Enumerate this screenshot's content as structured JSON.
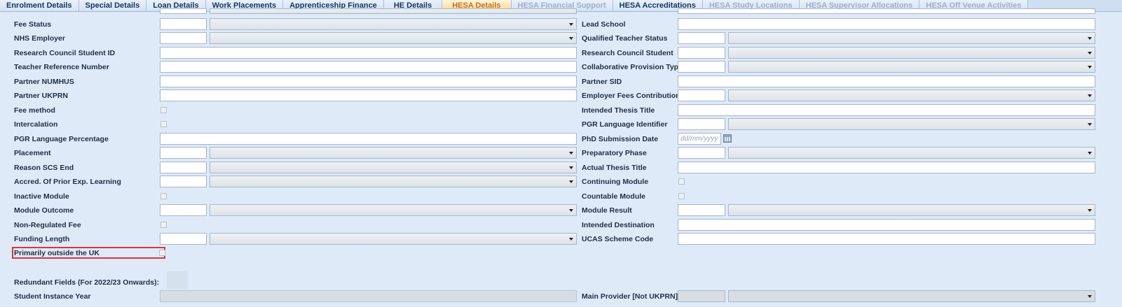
{
  "tabs": [
    {
      "label": "Enrolment Details",
      "state": "normal"
    },
    {
      "label": "Special Details",
      "state": "normal"
    },
    {
      "label": "Loan Details",
      "state": "normal"
    },
    {
      "label": "Work Placements",
      "state": "normal"
    },
    {
      "label": "Apprenticeship Finance",
      "state": "normal"
    },
    {
      "label": "HE Details",
      "state": "normal"
    },
    {
      "label": "HESA Details",
      "state": "active"
    },
    {
      "label": "HESA Financial Support",
      "state": "disabled"
    },
    {
      "label": "HESA Accreditations",
      "state": "normal"
    },
    {
      "label": "HESA Study Locations",
      "state": "disabled"
    },
    {
      "label": "HESA Supervisor Allocations",
      "state": "disabled"
    },
    {
      "label": "HESA Off Venue Activities",
      "state": "disabled"
    }
  ],
  "left": {
    "fee_status": "Fee Status",
    "nhs_employer": "NHS Employer",
    "research_council_student_id": "Research Council Student ID",
    "teacher_reference_number": "Teacher Reference Number",
    "partner_numhus": "Partner NUMHUS",
    "partner_ukprn": "Partner UKPRN",
    "fee_method": "Fee method",
    "intercalation": "Intercalation",
    "pgr_language_percentage": "PGR Language Percentage",
    "placement": "Placement",
    "reason_scs_end": "Reason SCS End",
    "accred_prior_exp": "Accred. Of Prior Exp. Learning",
    "inactive_module": "Inactive Module",
    "module_outcome": "Module Outcome",
    "non_regulated_fee": "Non-Regulated Fee",
    "funding_length": "Funding Length",
    "primarily_outside_uk": "Primarily outside the UK",
    "redundant_fields": "Redundant Fields (For 2022/23 Onwards):",
    "student_instance_year": "Student Instance Year"
  },
  "right": {
    "lead_school": "Lead School",
    "qualified_teacher_status": "Qualified Teacher Status",
    "research_council_student": "Research Council Student",
    "collaborative_provision_type": "Collaborative Provision Type",
    "partner_sid": "Partner SID",
    "employer_fees_contribution": "Employer Fees Contribution",
    "intended_thesis_title": "Intended Thesis Title",
    "pgr_language_identifier": "PGR Language Identifier",
    "phd_submission_date": "PhD Submission Date",
    "phd_submission_placeholder": "dd/mm/yyyy",
    "preparatory_phase": "Preparatory Phase",
    "actual_thesis_title": "Actual Thesis Title",
    "continuing_module": "Continuing Module",
    "countable_module": "Countable Module",
    "module_result": "Module Result",
    "intended_destination": "Intended Destination",
    "ucas_scheme_code": "UCAS Scheme Code",
    "main_provider": "Main Provider [Not UKPRN]"
  },
  "colors": {
    "highlight": "#e0333a",
    "active_tab_text": "#c9711a"
  }
}
